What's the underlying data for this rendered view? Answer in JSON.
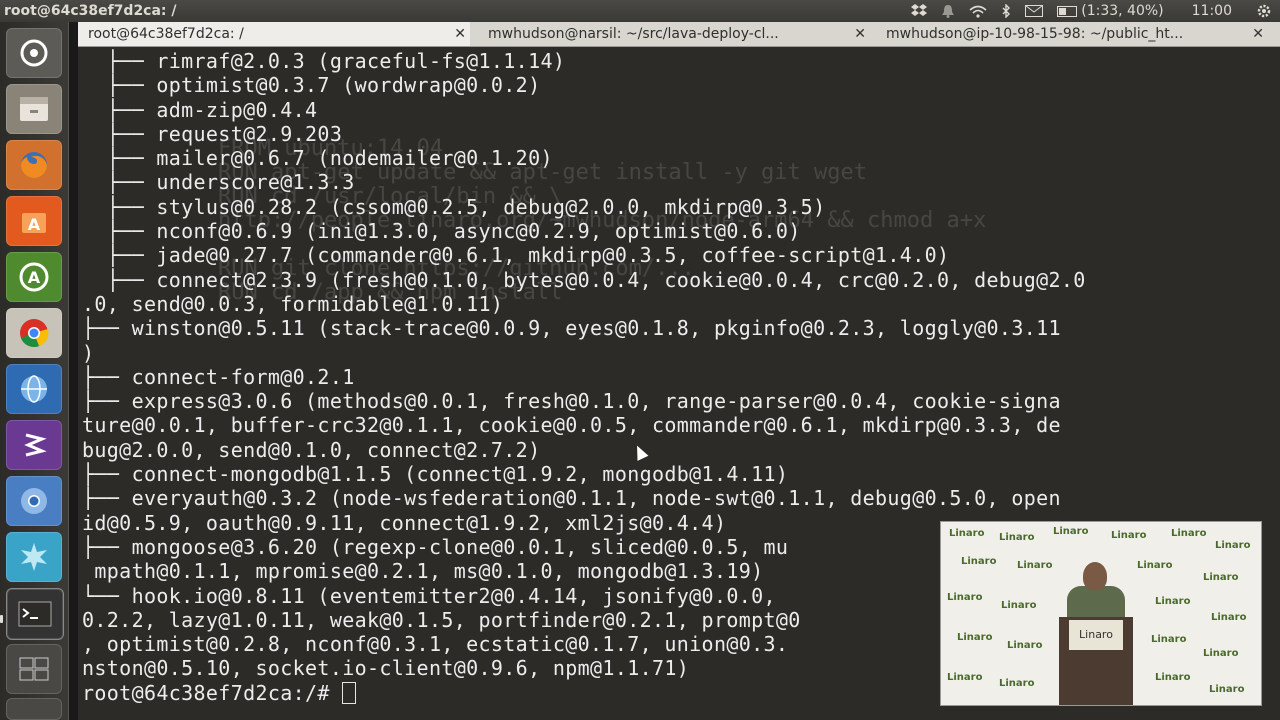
{
  "top_panel": {
    "title": "root@64c38ef7d2ca: /",
    "battery": "(1:33, 40%)",
    "battery_level": 0.4,
    "clock": "11:00",
    "icons": [
      "dropbox-icon",
      "notification-bell-icon",
      "wifi-icon",
      "bluetooth-icon",
      "mail-icon",
      "battery-icon",
      "gear-icon"
    ]
  },
  "tabs": [
    {
      "label": "root@64c38ef7d2ca: /",
      "active": true
    },
    {
      "label": "mwhudson@narsil: ~/src/lava-deploy-cl...",
      "active": false
    },
    {
      "label": "mwhudson@ip-10-98-15-98: ~/public_ht...",
      "active": false
    }
  ],
  "launcher": [
    "dash-home-icon",
    "files-icon",
    "firefox-icon",
    "software-center-icon",
    "update-manager-icon",
    "chrome-icon",
    "browser-globe-icon",
    "emacs-icon",
    "chromium-icon",
    "system-monitor-icon",
    "terminal-icon",
    "workspace-switcher-icon",
    "trash-icon"
  ],
  "colors": {
    "terminal_bg": "#2d2b28",
    "terminal_fg": "#ececec",
    "panel_bg": "#3c3b37",
    "tab_bar": "#d9d6d0"
  },
  "terminal": {
    "lines": [
      "  ├── rimraf@2.0.3 (graceful-fs@1.1.14)",
      "  ├── optimist@0.3.7 (wordwrap@0.0.2)",
      "  ├── adm-zip@0.4.4",
      "  ├── request@2.9.203",
      "  ├── mailer@0.6.7 (nodemailer@0.1.20)",
      "  ├── underscore@1.3.3",
      "  ├── stylus@0.28.2 (cssom@0.2.5, debug@2.0.0, mkdirp@0.3.5)",
      "  ├── nconf@0.6.9 (ini@1.3.0, async@0.2.9, optimist@0.6.0)",
      "  ├── jade@0.27.7 (commander@0.6.1, mkdirp@0.3.5, coffee-script@1.4.0)",
      "  ├── connect@2.3.9 (fresh@0.1.0, bytes@0.0.4, cookie@0.0.4, crc@0.2.0, debug@2.0",
      ".0, send@0.0.3, formidable@1.0.11)",
      "├── winston@0.5.11 (stack-trace@0.0.9, eyes@0.1.8, pkginfo@0.2.3, loggly@0.3.11",
      ")",
      "├── connect-form@0.2.1",
      "├── express@3.0.6 (methods@0.0.1, fresh@0.1.0, range-parser@0.0.4, cookie-signa",
      "ture@0.0.1, buffer-crc32@0.1.1, cookie@0.0.5, commander@0.6.1, mkdirp@0.3.3, de",
      "bug@2.0.0, send@0.1.0, connect@2.7.2)",
      "├── connect-mongodb@1.1.5 (connect@1.9.2, mongodb@1.4.11)",
      "├── everyauth@0.3.2 (node-wsfederation@0.1.1, node-swt@0.1.1, debug@0.5.0, open",
      "id@0.5.9, oauth@0.9.11, connect@1.9.2, xml2js@0.4.4)",
      "├── mongoose@3.6.20 (regexp-clone@0.0.1, sliced@0.0.5, mu",
      " mpath@0.1.1, mpromise@0.2.1, ms@0.1.0, mongodb@1.3.19)",
      "└── hook.io@0.8.11 (eventemitter2@0.4.14, jsonify@0.0.0,",
      "0.2.2, lazy@1.0.11, weak@0.1.5, portfinder@0.2.1, prompt@0",
      ", optimist@0.2.8, nconf@0.3.1, ecstatic@0.1.7, union@0.3.",
      "nston@0.5.10, socket.io-client@0.9.6, npm@1.1.71)"
    ],
    "prompt": "root@64c38ef7d2ca:/# ",
    "ghost_text": "FROM ubuntu:14.04\nRUN apt-get update && apt-get install -y git wget\nRUN cd /usr/local/bin && \\\nhttp://people.linaro.org/~mwhudson/node-arm64 && chmod a+x\n\nRUN git clone https://github.com/...\nRUN cd /app && npm install"
  },
  "video_inset": {
    "banner_text": "Linaro",
    "podium_text": "Linaro"
  }
}
